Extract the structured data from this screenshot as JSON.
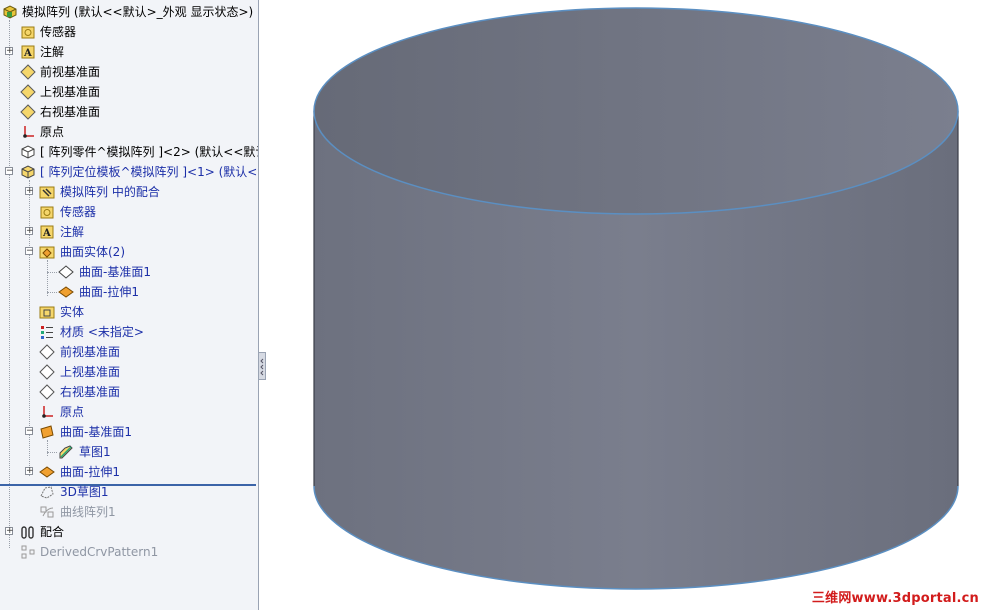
{
  "tree": {
    "items": [
      {
        "label": "模拟阵列 (默认<<默认>_外观 显示状态>)",
        "icon": "assembly-icon"
      },
      {
        "label": "传感器",
        "icon": "sensor-icon"
      },
      {
        "label": "注解",
        "icon": "annotation-icon"
      },
      {
        "label": "前视基准面",
        "icon": "plane-icon"
      },
      {
        "label": "上视基准面",
        "icon": "plane-icon"
      },
      {
        "label": "右视基准面",
        "icon": "plane-icon"
      },
      {
        "label": "原点",
        "icon": "origin-icon"
      },
      {
        "label": "[ 阵列零件^模拟阵列 ]<2> (默认<<默认",
        "icon": "part-icon"
      },
      {
        "label": "[ 阵列定位模板^模拟阵列 ]<1> (默认<<",
        "icon": "part-icon"
      },
      {
        "label": "模拟阵列 中的配合",
        "icon": "mates-folder-icon"
      },
      {
        "label": "传感器",
        "icon": "sensor-icon"
      },
      {
        "label": "注解",
        "icon": "annotation-icon"
      },
      {
        "label": "曲面实体(2)",
        "icon": "surface-bodies-folder-icon"
      },
      {
        "label": "曲面-基准面1",
        "icon": "surface-plane-icon"
      },
      {
        "label": "曲面-拉伸1",
        "icon": "surface-extrude-icon"
      },
      {
        "label": "实体",
        "icon": "solid-bodies-folder-icon"
      },
      {
        "label": "材质 <未指定>",
        "icon": "material-icon"
      },
      {
        "label": "前视基准面",
        "icon": "plane-icon"
      },
      {
        "label": "上视基准面",
        "icon": "plane-icon"
      },
      {
        "label": "右视基准面",
        "icon": "plane-icon"
      },
      {
        "label": "原点",
        "icon": "origin-icon"
      },
      {
        "label": "曲面-基准面1",
        "icon": "surface-plane-feature-icon"
      },
      {
        "label": "草图1",
        "icon": "sketch-icon"
      },
      {
        "label": "曲面-拉伸1",
        "icon": "surface-extrude-icon"
      },
      {
        "label": "3D草图1",
        "icon": "sketch-3d-icon"
      },
      {
        "label": "曲线阵列1",
        "icon": "curve-pattern-icon"
      },
      {
        "label": "配合",
        "icon": "mates-icon"
      },
      {
        "label": "DerivedCrvPattern1",
        "icon": "derived-pattern-icon"
      }
    ]
  },
  "watermark": "三维网www.3dportal.cn",
  "colors": {
    "cylinder_edge": "#5b8fc2",
    "text_blue": "#1c2fa8",
    "text_grey": "#8f96a3",
    "watermark": "#d21c1c"
  }
}
